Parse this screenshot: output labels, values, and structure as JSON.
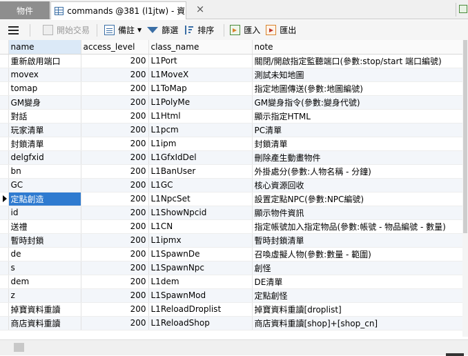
{
  "tabs": {
    "objects_label": "物件",
    "commands_label": "commands @381 (l1jtw) - 資...",
    "close_glyph": "×"
  },
  "toolbar": {
    "begin_transaction": "開始交易",
    "memo": "備註",
    "filter": "篩選",
    "sort": "排序",
    "import": "匯入",
    "export": "匯出"
  },
  "grid": {
    "columns": [
      "name",
      "access_level",
      "class_name",
      "note"
    ],
    "sorted_column": "name",
    "selected_row": 10,
    "rows": [
      {
        "name": "重新啟用端口",
        "access_level": "200",
        "class_name": "L1Port",
        "note": "關閉/開啟指定監聽端口(參數:stop/start 端口編號)"
      },
      {
        "name": "movex",
        "access_level": "200",
        "class_name": "L1MoveX",
        "note": "測試未知地圖"
      },
      {
        "name": "tomap",
        "access_level": "200",
        "class_name": "L1ToMap",
        "note": "指定地圖傳送(參數:地圖編號)"
      },
      {
        "name": "GM變身",
        "access_level": "200",
        "class_name": "L1PolyMe",
        "note": "GM變身指令(參數:變身代號)"
      },
      {
        "name": "對話",
        "access_level": "200",
        "class_name": "L1Html",
        "note": "顯示指定HTML"
      },
      {
        "name": "玩家清單",
        "access_level": "200",
        "class_name": "L1pcm",
        "note": "PC清單"
      },
      {
        "name": "封鎖清單",
        "access_level": "200",
        "class_name": "L1ipm",
        "note": "封鎖清單"
      },
      {
        "name": "delgfxid",
        "access_level": "200",
        "class_name": "L1GfxIdDel",
        "note": "刪除產生動畫物件"
      },
      {
        "name": "bn",
        "access_level": "200",
        "class_name": "L1BanUser",
        "note": "外掛處分(參數:人物名稱 - 分鐘)"
      },
      {
        "name": "GC",
        "access_level": "200",
        "class_name": "L1GC",
        "note": "核心資源回收"
      },
      {
        "name": "定點創造",
        "access_level": "200",
        "class_name": "L1NpcSet",
        "note": "設置定點NPC(參數:NPC編號)"
      },
      {
        "name": "id",
        "access_level": "200",
        "class_name": "L1ShowNpcid",
        "note": "顯示物件資訊"
      },
      {
        "name": "送禮",
        "access_level": "200",
        "class_name": "L1CN",
        "note": "指定帳號加入指定物品(參數:帳號 - 物品編號 - 數量)"
      },
      {
        "name": "暫時封鎖",
        "access_level": "200",
        "class_name": "L1ipmx",
        "note": "暫時封鎖清單"
      },
      {
        "name": "de",
        "access_level": "200",
        "class_name": "L1SpawnDe",
        "note": "召喚虛擬人物(參數:數量 - 範圍)"
      },
      {
        "name": "s",
        "access_level": "200",
        "class_name": "L1SpawnNpc",
        "note": "創怪"
      },
      {
        "name": "dem",
        "access_level": "200",
        "class_name": "L1dem",
        "note": "DE清單"
      },
      {
        "name": "z",
        "access_level": "200",
        "class_name": "L1SpawnMod",
        "note": "定點創怪"
      },
      {
        "name": "掉寶資料重讀",
        "access_level": "200",
        "class_name": "L1ReloadDroplist",
        "note": "掉寶資料重讀[droplist]"
      },
      {
        "name": "商店資料重讀",
        "access_level": "200",
        "class_name": "L1ReloadShop",
        "note": "商店資料重讀[shop]+[shop_cn]"
      }
    ]
  }
}
